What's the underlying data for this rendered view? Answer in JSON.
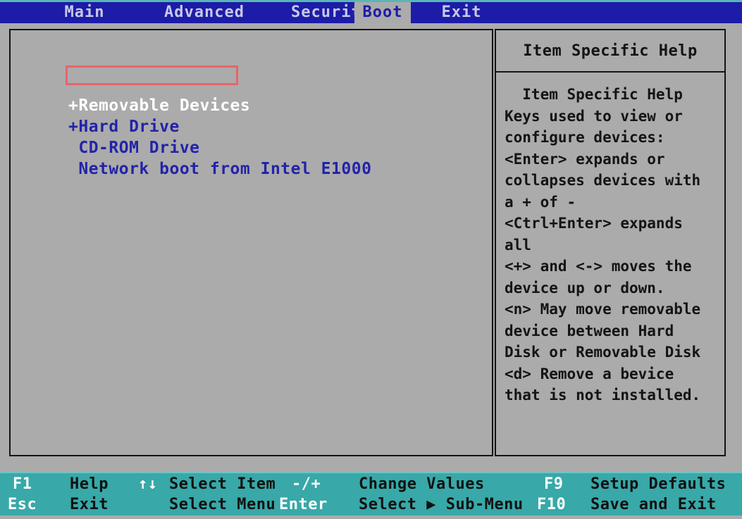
{
  "screen": {
    "type": "bios-setup-utility",
    "colors": {
      "menubar_bg": "#1c1ca8",
      "menubar_text": "#c8c8e8",
      "selected_tab_bg": "#ababab",
      "selected_tab_text": "#1c1ca8",
      "panel_bg": "#ababab",
      "panel_border": "#141414",
      "item_text": "#2323a8",
      "selected_item_text": "#ffffff",
      "help_text": "#141414",
      "statusbar_bg": "#38a8a8",
      "statusbar_key": "#ffffff",
      "statusbar_desc": "#111111",
      "annotation_box": "#e8646a"
    }
  },
  "menubar": {
    "tabs": [
      {
        "label": "Main",
        "selected": false
      },
      {
        "label": "Advanced",
        "selected": false
      },
      {
        "label": "Security",
        "selected": false
      },
      {
        "label": "Boot",
        "selected": true
      },
      {
        "label": "Exit",
        "selected": false
      }
    ]
  },
  "boot_list": {
    "items": [
      {
        "label": "+Removable Devices",
        "selected": true,
        "expandable": true
      },
      {
        "label": "+Hard Drive",
        "selected": false,
        "expandable": true
      },
      {
        "label": " CD-ROM Drive",
        "selected": false,
        "expandable": false
      },
      {
        "label": " Network boot from Intel E1000",
        "selected": false,
        "expandable": false
      }
    ]
  },
  "help_panel": {
    "title": "Item Specific Help",
    "lines": [
      "  Item Specific Help",
      "Keys used to view or",
      "configure devices:",
      "<Enter> expands or",
      "collapses devices with",
      "a + of -",
      "<Ctrl+Enter> expands",
      "all",
      "<+> and <-> moves the",
      "device up or down.",
      "<n> May move removable",
      "device between Hard",
      "Disk or Removable Disk",
      "<d> Remove a bevice",
      "that is not installed."
    ]
  },
  "statusbar": {
    "row1": [
      {
        "key": "F1",
        "desc": "Help"
      },
      {
        "key": "↑↓",
        "desc": "Select Item"
      },
      {
        "key": "-/+",
        "desc": "Change Values"
      },
      {
        "key": "F9",
        "desc": "Setup Defaults"
      }
    ],
    "row2": [
      {
        "key": "Esc",
        "desc": "Exit"
      },
      {
        "key": "",
        "desc": "Select Menu"
      },
      {
        "key": "Enter",
        "desc": "Select ▶ Sub-Menu"
      },
      {
        "key": "F10",
        "desc": "Save and Exit"
      }
    ]
  }
}
